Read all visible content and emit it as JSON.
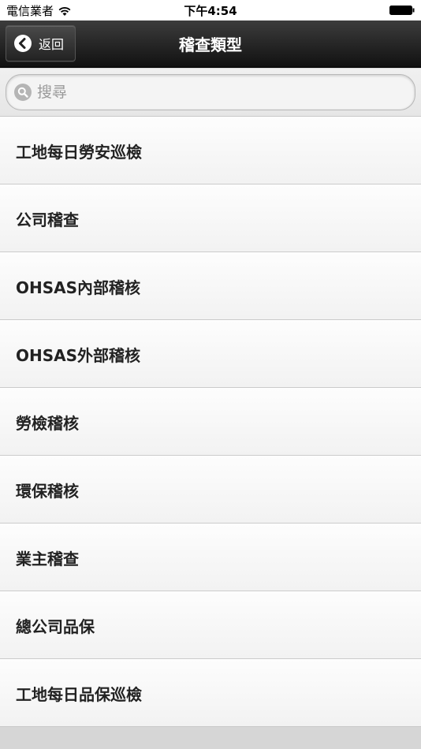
{
  "status_bar": {
    "carrier": "電信業者",
    "time": "下午4:54"
  },
  "nav": {
    "back_label": "返回",
    "title": "稽查類型"
  },
  "search": {
    "placeholder": "搜尋",
    "value": ""
  },
  "list": {
    "items": [
      {
        "label": "工地每日勞安巡檢"
      },
      {
        "label": "公司稽查"
      },
      {
        "label": "OHSAS內部稽核"
      },
      {
        "label": "OHSAS外部稽核"
      },
      {
        "label": "勞檢稽核"
      },
      {
        "label": "環保稽核"
      },
      {
        "label": "業主稽查"
      },
      {
        "label": "總公司品保"
      },
      {
        "label": "工地每日品保巡檢"
      }
    ]
  },
  "icons": {
    "back": "chevron-left-circle-icon",
    "search": "magnifier-icon",
    "wifi": "wifi-icon",
    "battery": "battery-icon"
  },
  "colors": {
    "nav_background": "#1e1e1e",
    "list_background": "#f7f7f7",
    "text": "#222222"
  }
}
